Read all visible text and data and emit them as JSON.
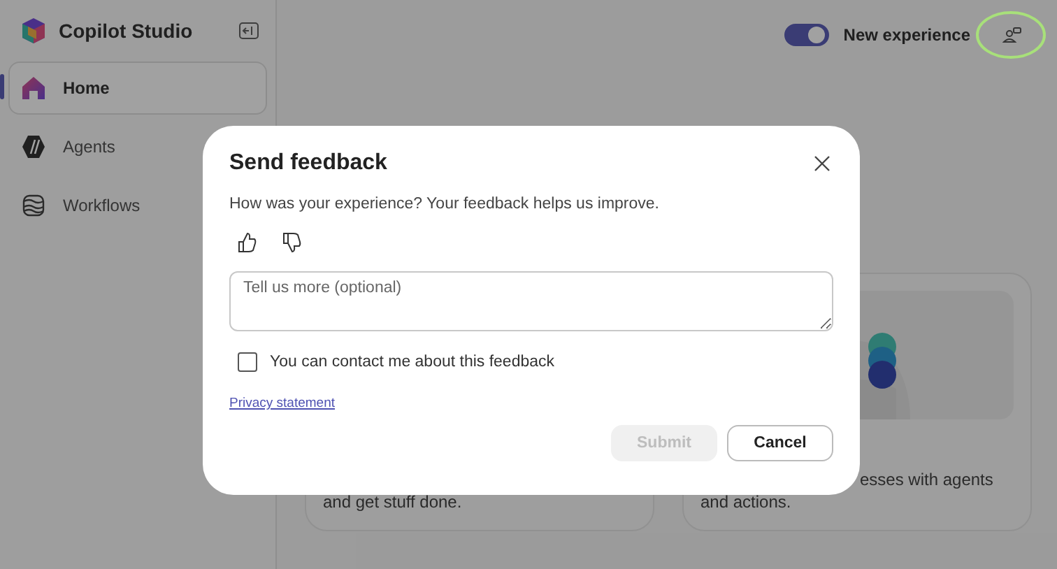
{
  "app": {
    "title": "Copilot Studio"
  },
  "nav": [
    {
      "label": "Home",
      "kind": "home",
      "selected": true
    },
    {
      "label": "Agents",
      "kind": "agents",
      "selected": false
    },
    {
      "label": "Workflows",
      "kind": "workflows",
      "selected": false
    }
  ],
  "header": {
    "toggle": {
      "label": "New experience",
      "on": true
    }
  },
  "cards": [
    {
      "lines": [
        "and get stuff done."
      ],
      "kind": "text"
    },
    {
      "lines": [
        "esses with agents",
        "and actions."
      ],
      "kind": "picture"
    }
  ],
  "dialog": {
    "title": "Send feedback",
    "prompt": "How was your experience? Your feedback helps us improve.",
    "comment": {
      "placeholder": "Tell us more (optional)"
    },
    "contact": {
      "label": "You can contact me about this feedback",
      "checked": false
    },
    "privacy_link": "Privacy statement",
    "buttons": [
      {
        "label": "Submit",
        "kind": "primary",
        "disabled": true
      },
      {
        "label": "Cancel",
        "kind": "secondary",
        "disabled": false
      }
    ]
  }
}
